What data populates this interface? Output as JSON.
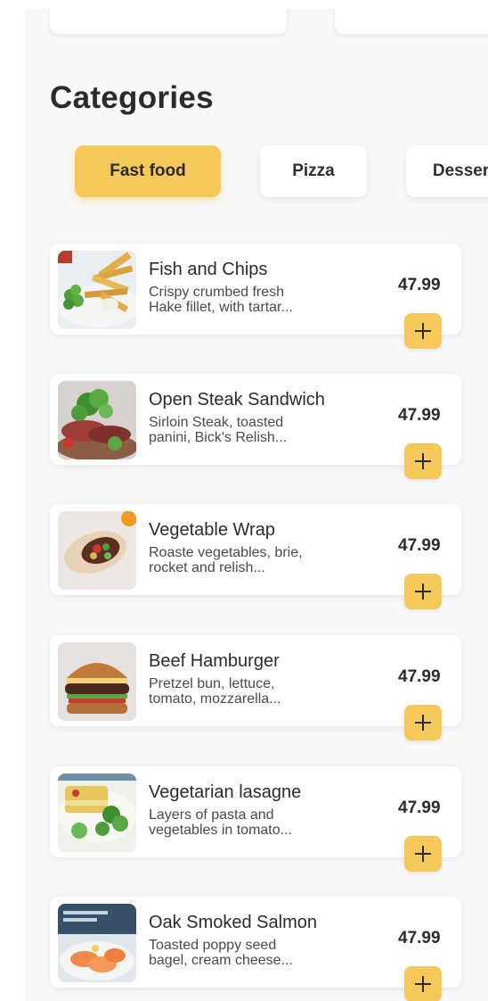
{
  "section_title": "Categories",
  "categories": [
    {
      "label": "Fast food",
      "active": true
    },
    {
      "label": "Pizza",
      "active": false
    },
    {
      "label": "Desserts",
      "active": false
    }
  ],
  "items": [
    {
      "name": "Fish and Chips",
      "desc_line1": "Crispy crumbed fresh",
      "desc_line2": "Hake fillet, with tartar...",
      "price": "47.99",
      "image_icon": "fish-and-chips-image"
    },
    {
      "name": "Open Steak Sandwich",
      "desc_line1": "Sirloin Steak, toasted",
      "desc_line2": "panini, Bick's Relish...",
      "price": "47.99",
      "image_icon": "steak-sandwich-image"
    },
    {
      "name": "Vegetable Wrap",
      "desc_line1": "Roaste vegetables, brie,",
      "desc_line2": "rocket and relish...",
      "price": "47.99",
      "image_icon": "vegetable-wrap-image"
    },
    {
      "name": "Beef Hamburger",
      "desc_line1": "Pretzel bun, lettuce,",
      "desc_line2": "tomato, mozzarella...",
      "price": "47.99",
      "image_icon": "beef-hamburger-image"
    },
    {
      "name": "Vegetarian lasagne",
      "desc_line1": "Layers of pasta and",
      "desc_line2": "vegetables in tomato...",
      "price": "47.99",
      "image_icon": "lasagne-image"
    },
    {
      "name": "Oak Smoked Salmon",
      "desc_line1": "Toasted poppy seed",
      "desc_line2": "bagel, cream cheese...",
      "price": "47.99",
      "image_icon": "smoked-salmon-image"
    }
  ],
  "colors": {
    "accent": "#f5c85a",
    "text": "#2b2b2b",
    "background": "#f8f8fa"
  }
}
